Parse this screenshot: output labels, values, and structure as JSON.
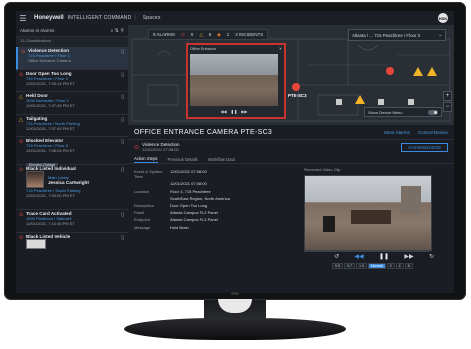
{
  "app": {
    "brand": "Honeywell",
    "title": "INTELLIGENT COMMAND",
    "section": "Spaces",
    "avatar": "HSK"
  },
  "sidebar": {
    "header": "Alarms in Alarms",
    "count": "13 Classifications",
    "alarms": [
      {
        "icon": "red-alert-icon",
        "title": "Violence Detection",
        "line1": "715 Peachtree / Floor 3",
        "line2": "Office Entrance Camera",
        "selected": true
      },
      {
        "icon": "red-alert-icon",
        "title": "Door Open Too Long",
        "line1": "715 Peachtree / Floor 3",
        "line2": "12/01/2021, 7:05:14 PM ET",
        "tag": ""
      },
      {
        "icon": "yellow-warning-icon",
        "title": "Held Door",
        "line1": "1000 Northside / Floor 1",
        "line2": "12/01/2021, 7:07:45 PM ET"
      },
      {
        "icon": "yellow-warning-icon",
        "title": "Tailgating",
        "line1": "715 Peachtree / North Parking",
        "line2": "12/01/2021, 7:07:45 PM ET"
      },
      {
        "icon": "red-alert-icon",
        "title": "Blocked Elevator",
        "line1": "715 Peachtree / Floor 8",
        "line2": "12/01/2021, 7:08:04 PM ET",
        "tag": "Elevator Outage"
      },
      {
        "icon": "red-alert-icon",
        "title": "Black Listed Individual",
        "line1": "Main Lobby",
        "person": "Jessica Cartwright",
        "line2": "715 Peachtree / South Parking",
        "line3": "12/01/2021, 7:09:00 PM ET"
      },
      {
        "icon": "red-alert-icon",
        "title": "Trace Card Activated",
        "line1": "1000 Piedmont / Stairwell",
        "line2": "12/01/2021, 7:10:45 PM ET"
      },
      {
        "icon": "red-alert-icon",
        "title": "Black Listed Vehicle",
        "line1": "",
        "line2": ""
      }
    ]
  },
  "map": {
    "stats": {
      "alarms": "9 ALARMS",
      "red": "0",
      "yellow": "8",
      "orange": "1",
      "incidents": "3 INCIDENTS"
    },
    "site_select": "Atlanta / ... 715 Peachtree / Floor 3",
    "popup_title": "Office Entrance",
    "camera_label": "PTE-SC3",
    "show_menu": "Show Device Menu"
  },
  "detail": {
    "title": "OFFICE ENTRANCE CAMERA PTE-SC3",
    "more_alarms": "More Alarms",
    "control_device": "Control Device",
    "alarm_type": "Violence Detection",
    "alarm_time": "12/01/2021 07:08:00",
    "acknowledge": "ACKNOWLEDGE",
    "tabs": [
      "Action Steps",
      "Previous Details",
      "Workflow Data"
    ],
    "fields": [
      {
        "k": "Event & System Time",
        "v": "12/01/2021 07:08:00"
      },
      {
        "k": "",
        "v": "12/01/2021 07:08:00"
      },
      {
        "k": "Location",
        "v": "Floor 3, 715 Peachtree"
      },
      {
        "k": "",
        "v": "SouthEast Region, North America"
      },
      {
        "k": "Description",
        "v": "Door Open Too Long"
      },
      {
        "k": "Panel",
        "v": "Atlanta Campus FL3 Panel"
      },
      {
        "k": "Endpoint",
        "v": "Atlanta Campus FL3 Panel"
      },
      {
        "k": "Message",
        "v": "Hold Brain"
      }
    ],
    "recorded": "Recorded Video Clip",
    "speeds": [
      "0.5",
      "0.7",
      "1.0",
      "Normal",
      "2",
      "4",
      "8"
    ]
  }
}
